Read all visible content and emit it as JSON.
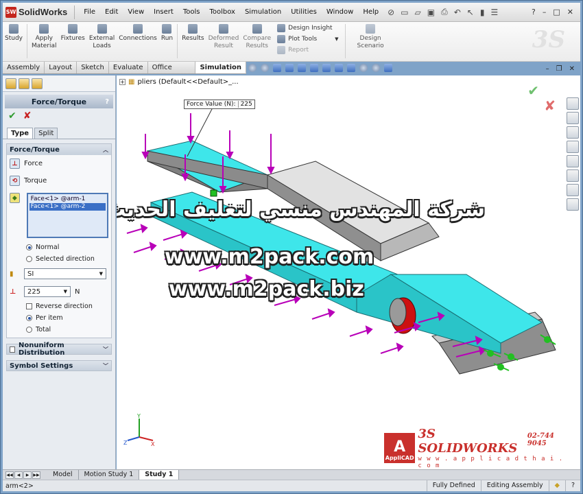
{
  "app": {
    "logo_text": "SolidWorks",
    "logo_mark": "SW"
  },
  "menu": [
    "File",
    "Edit",
    "View",
    "Insert",
    "Tools",
    "Toolbox",
    "Simulation",
    "Utilities",
    "Window",
    "Help"
  ],
  "window_controls": [
    "?",
    "–",
    "□",
    "✕"
  ],
  "commands": [
    {
      "label": "Study"
    },
    {
      "label": "Apply\nMaterial"
    },
    {
      "label": "Fixtures"
    },
    {
      "label": "External\nLoads"
    },
    {
      "label": "Connections"
    },
    {
      "label": "Run"
    },
    {
      "label": "Results"
    },
    {
      "label": "Deformed\nResult"
    },
    {
      "label": "Compare\nResults"
    }
  ],
  "command_list": {
    "design_insight": "Design Insight",
    "plot_tools": "Plot Tools",
    "report": "Report"
  },
  "design_scenario": "Design\nScenario",
  "tabs": [
    "Assembly",
    "Layout",
    "Sketch",
    "Evaluate",
    "Office Products",
    "Simulation"
  ],
  "active_tab": "Simulation",
  "property_manager": {
    "title": "Force/Torque",
    "help": "?",
    "ok": "✔",
    "cancel": "✘",
    "subtabs": [
      "Type",
      "Split"
    ],
    "group_title": "Force/Torque",
    "force_label": "Force",
    "torque_label": "Torque",
    "faces": [
      "Face<1> @arm-1",
      "Face<1> @arm-2"
    ],
    "normal": "Normal",
    "selected_direction": "Selected direction",
    "units": "SI",
    "force_value": "225",
    "force_unit": "N",
    "reverse_direction": "Reverse direction",
    "per_item": "Per item",
    "total": "Total",
    "nonuniform": "Nonuniform Distribution",
    "symbol_settings": "Symbol Settings"
  },
  "graphics": {
    "tree_label": "pliers  (Default<<Default>_...",
    "callout_label": "Force Value (N):",
    "callout_value": "225",
    "watermark_arabic": "شركة المهندس منسي لتغليف الحديث",
    "watermark_url_1": "www.m2pack.com",
    "watermark_url_2": "www.m2pack.biz",
    "triad_x": "X",
    "triad_y": "Y",
    "triad_z": "Z",
    "brand_badge": "AppliCAD",
    "brand_ds": "3S SOLIDWORKS",
    "brand_phone": "02-744 9045",
    "brand_url": "w w w . a p p l i c a d t h a i . c o m"
  },
  "bottom_tabs": [
    "Model",
    "Motion Study 1",
    "Study 1"
  ],
  "active_bottom_tab": "Study 1",
  "status": {
    "selection": "arm<2>",
    "defined": "Fully Defined",
    "mode": "Editing Assembly"
  },
  "colors": {
    "arrow": "#b800b8",
    "part_cyan": "#3ee6ea",
    "fixture": "#22c022"
  }
}
